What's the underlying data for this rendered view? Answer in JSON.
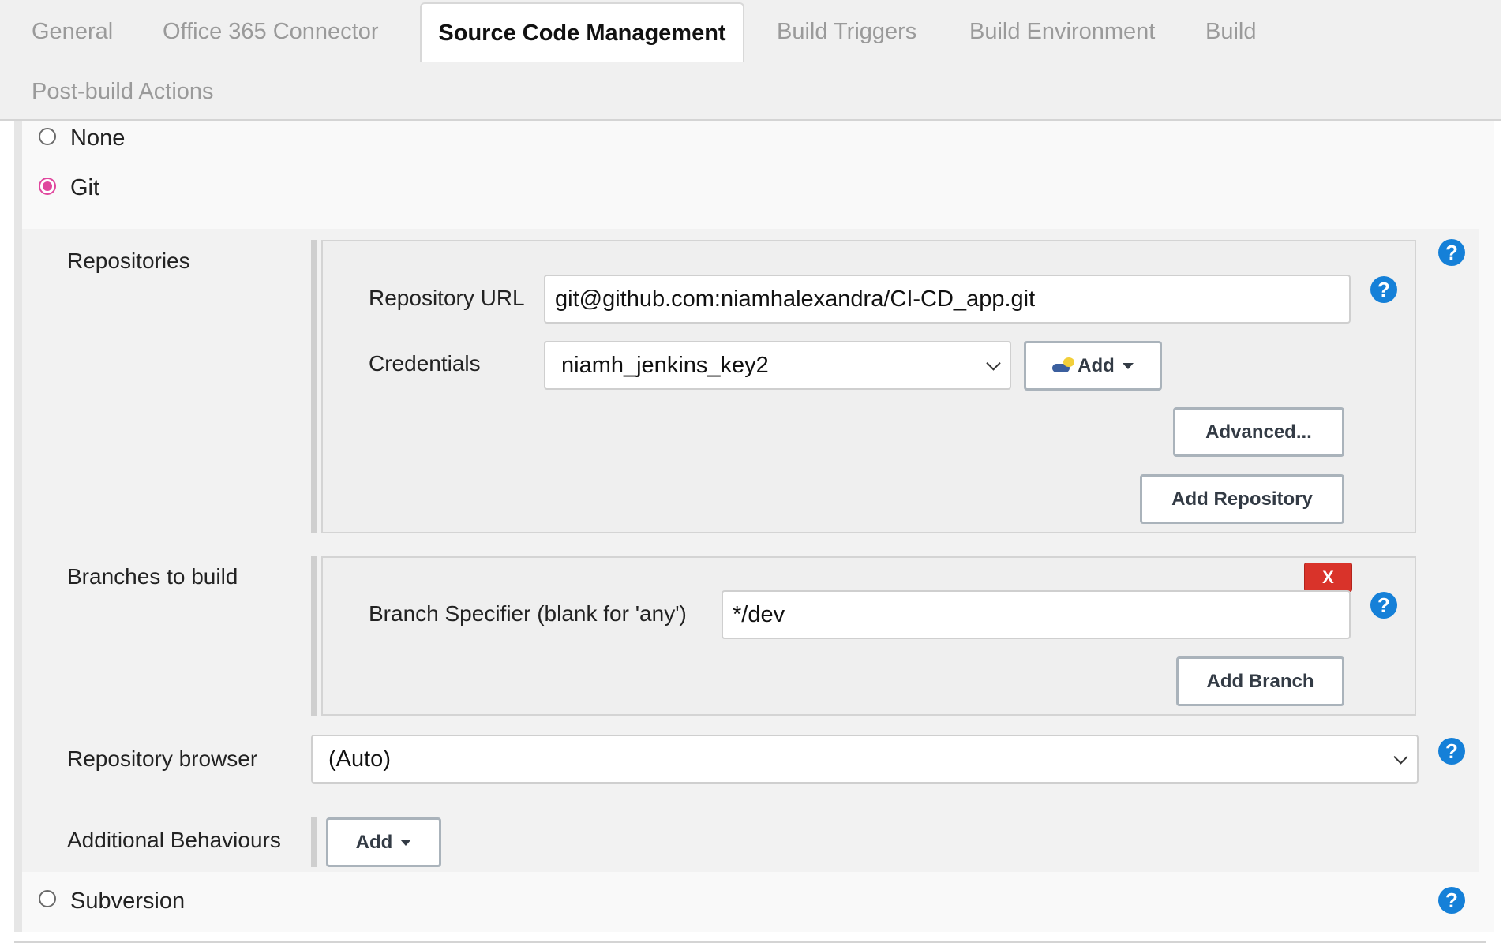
{
  "tabs": [
    {
      "label": "General",
      "active": false
    },
    {
      "label": "Office 365 Connector",
      "active": false
    },
    {
      "label": "Source Code Management",
      "active": true
    },
    {
      "label": "Build Triggers",
      "active": false
    },
    {
      "label": "Build Environment",
      "active": false
    },
    {
      "label": "Build",
      "active": false
    },
    {
      "label": "Post-build Actions",
      "active": false
    }
  ],
  "scm": {
    "options": {
      "none": {
        "label": "None",
        "selected": false
      },
      "git": {
        "label": "Git",
        "selected": true
      },
      "subversion": {
        "label": "Subversion",
        "selected": false
      }
    },
    "repositories": {
      "section_label": "Repositories",
      "url_label": "Repository URL",
      "url_value": "git@github.com:niamhalexandra/CI-CD_app.git",
      "credentials_label": "Credentials",
      "credentials_value": "niamh_jenkins_key2",
      "add_label": "Add",
      "advanced_label": "Advanced...",
      "add_repository_label": "Add Repository"
    },
    "branches": {
      "section_label": "Branches to build",
      "remove_label": "X",
      "specifier_label": "Branch Specifier (blank for 'any')",
      "specifier_value": "*/dev",
      "add_branch_label": "Add Branch"
    },
    "browser": {
      "label": "Repository browser",
      "value": "(Auto)"
    },
    "behaviours": {
      "label": "Additional Behaviours",
      "add_label": "Add"
    },
    "help_symbol": "?"
  },
  "colors": {
    "accent_radio": "#e0479e",
    "help_icon": "#1580d8",
    "delete_button": "#d9332a"
  }
}
